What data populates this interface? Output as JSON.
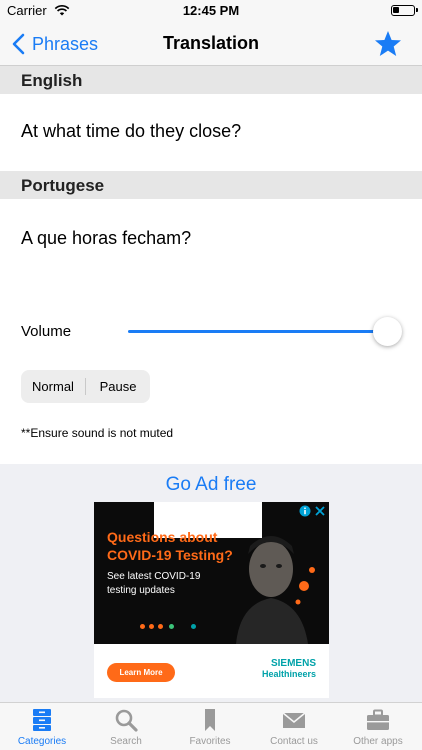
{
  "status_bar": {
    "carrier": "Carrier",
    "time": "12:45 PM"
  },
  "nav": {
    "back_label": "Phrases",
    "title": "Translation"
  },
  "source": {
    "language": "English",
    "phrase": "At what time do they close?"
  },
  "target": {
    "language": "Portugese",
    "phrase": "A que horas fecham?"
  },
  "volume": {
    "label": "Volume",
    "level": 1.0
  },
  "speed_control": {
    "options": [
      "Normal",
      "Pause"
    ]
  },
  "note": "**Ensure sound is not muted",
  "ad": {
    "go_ad_free": "Go Ad free",
    "headline": "Questions about COVID-19 Testing?",
    "subtext": "See latest COVID-19 testing updates",
    "cta": "Learn More",
    "brand_line1": "SIEMENS",
    "brand_line2": "Healthineers"
  },
  "tabs": [
    {
      "label": "Categories",
      "icon": "categories-icon",
      "active": true
    },
    {
      "label": "Search",
      "icon": "search-icon",
      "active": false
    },
    {
      "label": "Favorites",
      "icon": "bookmark-icon",
      "active": false
    },
    {
      "label": "Contact us",
      "icon": "mail-icon",
      "active": false
    },
    {
      "label": "Other apps",
      "icon": "briefcase-icon",
      "active": false
    }
  ],
  "colors": {
    "accent": "#1a7cf5",
    "ad_orange": "#ff6a18",
    "ad_teal": "#00a2a9"
  }
}
